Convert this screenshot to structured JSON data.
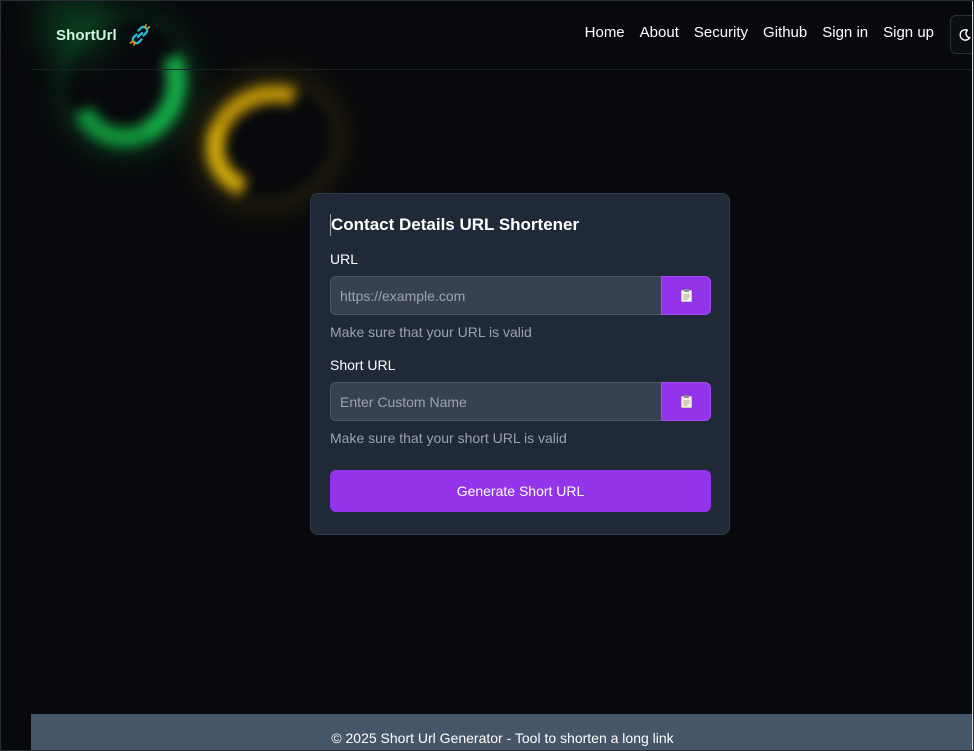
{
  "header": {
    "brand": "ShortUrl",
    "nav": [
      "Home",
      "About",
      "Security",
      "Github",
      "Sign in",
      "Sign up"
    ]
  },
  "icons": {
    "brand": "chain-link-icon",
    "theme_toggle": "moon-icon",
    "paste": "clipboard-icon"
  },
  "form": {
    "title": "Contact Details URL Shortener",
    "url_label": "URL",
    "url_placeholder": "https://example.com",
    "url_value": "",
    "url_helper": "Make sure that your URL is valid",
    "short_label": "Short URL",
    "short_placeholder": "Enter Custom Name",
    "short_value": "",
    "short_helper": "Make sure that your short URL is valid",
    "submit_label": "Generate Short URL"
  },
  "footer": {
    "text": "© 2025 Short Url Generator - Tool to shorten a long link"
  },
  "colors": {
    "background": "#08090c",
    "card": "#1f2937",
    "accent": "#9333ea",
    "brand_text": "#cdf7dc",
    "footer": "#475569"
  }
}
